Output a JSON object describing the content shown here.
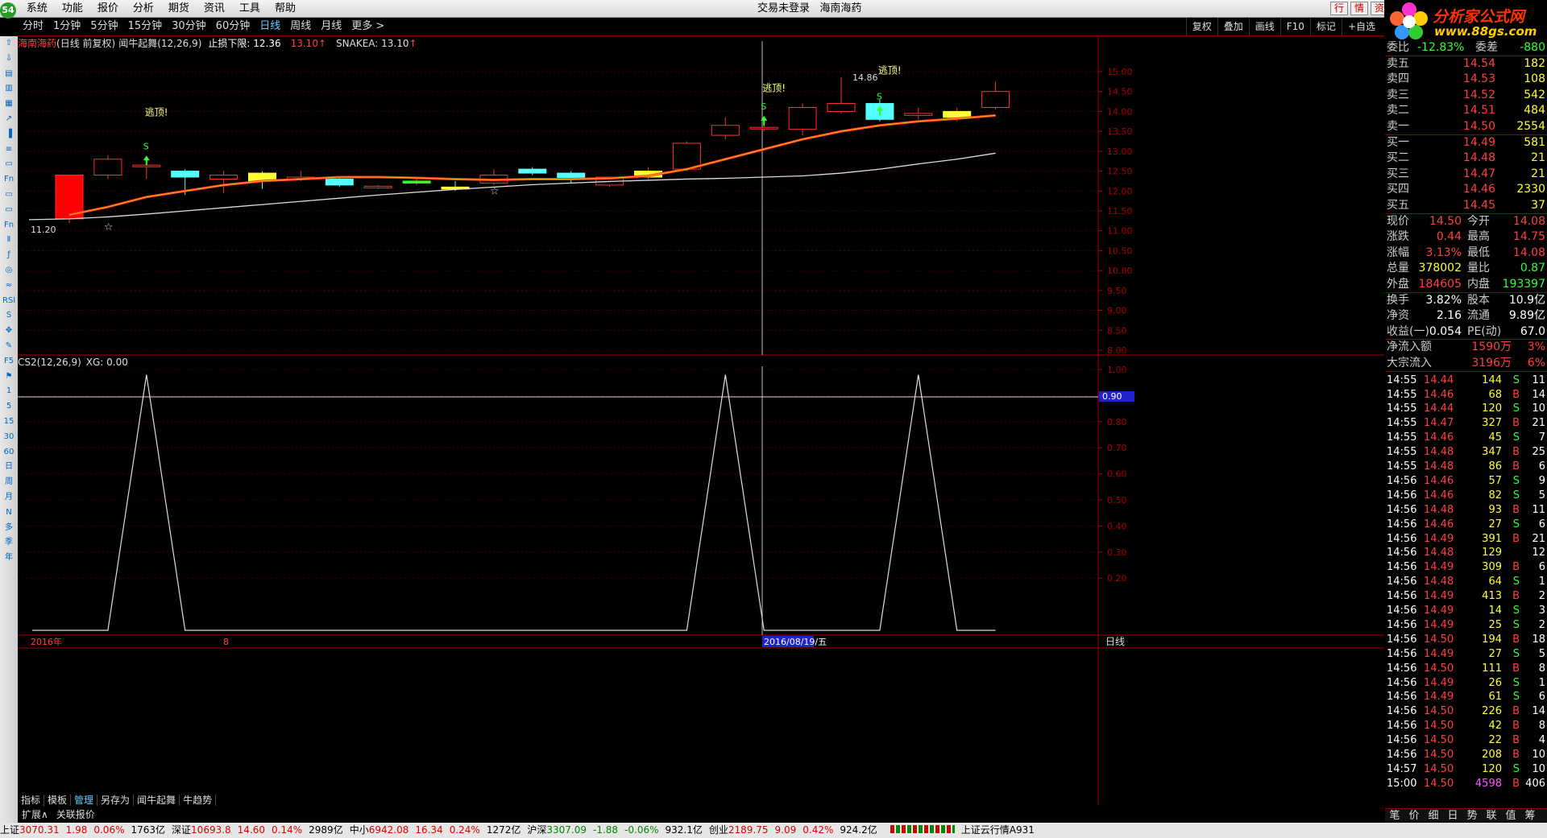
{
  "menu": [
    "系统",
    "功能",
    "报价",
    "分析",
    "期货",
    "资讯",
    "工具",
    "帮助"
  ],
  "app_badge": "54",
  "window_title": {
    "login": "交易未登录",
    "stock": "海南海药"
  },
  "top_right_buttons": [
    "行",
    "情",
    "资"
  ],
  "brand": {
    "name": "分析家公式网",
    "url": "www.88gs.com"
  },
  "periods": [
    "分时",
    "1分钟",
    "5分钟",
    "15分钟",
    "30分钟",
    "60分钟",
    "日线",
    "周线",
    "月线",
    "更多 >"
  ],
  "active_period": "日线",
  "chart_tools": [
    "复权",
    "叠加",
    "画线",
    "F10",
    "标记",
    "+自选"
  ],
  "left_toolbar": [
    "⇧",
    "⇩",
    "▤",
    "▥",
    "▦",
    "↗",
    "▐",
    "≡",
    "▭",
    "Fn",
    "▭",
    "▭",
    "Fn",
    "Ⅱ",
    "ƒ",
    "◎",
    "≈",
    "RSI",
    "S",
    "✥",
    "✎",
    "F5",
    "⚑",
    "1",
    "5",
    "15",
    "30",
    "60",
    "日",
    "周",
    "月",
    "N",
    "多",
    "季",
    "年"
  ],
  "main_header": {
    "stock": "海南海药",
    "mode": "(日线 前复权)",
    "indicator": "闻牛起舞(12,26,9)",
    "stop_label": "止损下限: 12.36",
    "stop_value": "13.10",
    "snake": "SNAKEA: 13.10"
  },
  "price_axis": [
    "15.00",
    "14.50",
    "14.00",
    "13.50",
    "13.00",
    "12.50",
    "12.00",
    "11.50",
    "11.00",
    "10.50",
    "10.00",
    "9.50",
    "9.00",
    "8.50",
    "8.00"
  ],
  "annotations": {
    "low_label": "11.20",
    "high_label": "14.86",
    "escape": "逃顶!",
    "s": "S"
  },
  "sub_header": {
    "name": "CS2(12,26,9)",
    "xg": "XG: 0.00"
  },
  "sub_axis": [
    "1.00",
    "0.90",
    "0.80",
    "0.70",
    "0.60",
    "0.50",
    "0.40",
    "0.30",
    "0.20"
  ],
  "sub_marker": "0.90",
  "date_axis": {
    "year": "2016年",
    "month": "8",
    "cursor": "2016/08/19/五",
    "period": "日线"
  },
  "candles": [
    {
      "o": 11.3,
      "c": 12.4,
      "h": 12.4,
      "l": 11.2,
      "hl": "yel"
    },
    {
      "o": 12.4,
      "c": 12.8,
      "h": 12.9,
      "l": 12.3
    },
    {
      "o": 12.65,
      "c": 12.65,
      "h": 12.75,
      "l": 12.3,
      "cross": true
    },
    {
      "o": 12.5,
      "c": 12.35,
      "h": 12.55,
      "l": 11.9,
      "fill": "#5ff"
    },
    {
      "o": 12.3,
      "c": 12.4,
      "h": 12.5,
      "l": 11.95
    },
    {
      "o": 12.45,
      "c": 12.25,
      "h": 12.5,
      "l": 12.05,
      "fill": "#ff3"
    },
    {
      "o": 12.3,
      "c": 12.35,
      "h": 12.5,
      "l": 12.25,
      "cross": true
    },
    {
      "o": 12.3,
      "c": 12.15,
      "h": 12.35,
      "l": 12.1,
      "fill": "#5ff"
    },
    {
      "o": 12.1,
      "c": 12.12,
      "h": 12.15,
      "l": 12.05,
      "cross": true
    },
    {
      "o": 12.2,
      "c": 12.25,
      "h": 12.3,
      "l": 12.15,
      "cross": true,
      "fill": "#3f3"
    },
    {
      "o": 12.1,
      "c": 12.05,
      "h": 12.25,
      "l": 12.0,
      "fill": "#ff3"
    },
    {
      "o": 12.2,
      "c": 12.4,
      "h": 12.55,
      "l": 12.15
    },
    {
      "o": 12.55,
      "c": 12.45,
      "h": 12.6,
      "l": 12.4,
      "fill": "#5ff"
    },
    {
      "o": 12.45,
      "c": 12.3,
      "h": 12.5,
      "l": 12.2,
      "fill": "#5ff"
    },
    {
      "o": 12.15,
      "c": 12.35,
      "h": 12.35,
      "l": 12.1
    },
    {
      "o": 12.35,
      "c": 12.5,
      "h": 12.6,
      "l": 12.3,
      "fill": "#ff3"
    },
    {
      "o": 12.55,
      "c": 13.2,
      "h": 13.25,
      "l": 12.5
    },
    {
      "o": 13.4,
      "c": 13.65,
      "h": 13.85,
      "l": 13.3
    },
    {
      "o": 13.6,
      "c": 13.6,
      "h": 13.8,
      "l": 13.5,
      "cross": true
    },
    {
      "o": 13.55,
      "c": 14.1,
      "h": 14.2,
      "l": 13.4
    },
    {
      "o": 14.0,
      "c": 14.2,
      "h": 14.86,
      "l": 13.95
    },
    {
      "o": 14.2,
      "c": 13.8,
      "h": 14.3,
      "l": 13.75,
      "fill": "#5ff"
    },
    {
      "o": 13.9,
      "c": 13.95,
      "h": 14.1,
      "l": 13.8,
      "cross": true
    },
    {
      "o": 13.85,
      "c": 14.0,
      "h": 14.1,
      "l": 13.75,
      "fill": "#ff3"
    },
    {
      "o": 14.1,
      "c": 14.5,
      "h": 14.75,
      "l": 14.05
    }
  ],
  "ma_red": [
    11.4,
    11.6,
    11.85,
    12.0,
    12.15,
    12.25,
    12.3,
    12.35,
    12.35,
    12.33,
    12.3,
    12.28,
    12.3,
    12.3,
    12.32,
    12.38,
    12.55,
    12.8,
    13.05,
    13.3,
    13.5,
    13.65,
    13.75,
    13.82,
    13.9
  ],
  "ma_white": [
    11.3,
    11.35,
    11.42,
    11.5,
    11.58,
    11.66,
    11.74,
    11.82,
    11.9,
    11.97,
    12.04,
    12.1,
    12.16,
    12.2,
    12.24,
    12.27,
    12.3,
    12.32,
    12.35,
    12.38,
    12.45,
    12.55,
    12.68,
    12.8,
    12.95
  ],
  "sub_series": [
    0,
    0,
    0.98,
    0,
    0,
    0,
    0,
    0,
    0,
    0,
    0,
    0,
    0,
    0,
    0,
    0,
    0,
    0.98,
    0,
    0,
    0,
    0,
    0.98,
    0,
    0
  ],
  "quote": {
    "weibi": {
      "label": "委比",
      "value": "-12.83%",
      "label2": "委差",
      "value2": "-880"
    },
    "sell": [
      {
        "l": "卖五",
        "p": "14.54",
        "v": "182"
      },
      {
        "l": "卖四",
        "p": "14.53",
        "v": "108"
      },
      {
        "l": "卖三",
        "p": "14.52",
        "v": "542"
      },
      {
        "l": "卖二",
        "p": "14.51",
        "v": "484"
      },
      {
        "l": "卖一",
        "p": "14.50",
        "v": "2554"
      }
    ],
    "buy": [
      {
        "l": "买一",
        "p": "14.49",
        "v": "581"
      },
      {
        "l": "买二",
        "p": "14.48",
        "v": "21"
      },
      {
        "l": "买三",
        "p": "14.47",
        "v": "21"
      },
      {
        "l": "买四",
        "p": "14.46",
        "v": "2330"
      },
      {
        "l": "买五",
        "p": "14.45",
        "v": "37"
      }
    ],
    "stats": [
      {
        "l": "现价",
        "v": "14.50",
        "l2": "今开",
        "v2": "14.08"
      },
      {
        "l": "涨跌",
        "v": "0.44",
        "l2": "最高",
        "v2": "14.75"
      },
      {
        "l": "涨幅",
        "v": "3.13%",
        "l2": "最低",
        "v2": "14.08"
      },
      {
        "l": "总量",
        "v": "378002",
        "l2": "量比",
        "v2": "0.87"
      },
      {
        "l": "外盘",
        "v": "184605",
        "l2": "内盘",
        "v2": "193397"
      }
    ],
    "stats2": [
      {
        "l": "换手",
        "v": "3.82%",
        "l2": "股本",
        "v2": "10.9亿"
      },
      {
        "l": "净资",
        "v": "2.16",
        "l2": "流通",
        "v2": "9.89亿"
      },
      {
        "l": "收益(一)",
        "v": "0.054",
        "l2": "PE(动)",
        "v2": "67.0"
      }
    ],
    "flow": [
      {
        "l": "净流入额",
        "v": "1590万",
        "p": "3%"
      },
      {
        "l": "大宗流入",
        "v": "3196万",
        "p": "6%"
      }
    ]
  },
  "ticks": [
    [
      "14:55",
      "14.44",
      "144",
      "S",
      "11"
    ],
    [
      "14:55",
      "14.46",
      "68",
      "B",
      "14"
    ],
    [
      "14:55",
      "14.44",
      "120",
      "S",
      "10"
    ],
    [
      "14:55",
      "14.47",
      "327",
      "B",
      "21"
    ],
    [
      "14:55",
      "14.46",
      "45",
      "S",
      "7"
    ],
    [
      "14:55",
      "14.48",
      "347",
      "B",
      "25"
    ],
    [
      "14:55",
      "14.48",
      "86",
      "B",
      "6"
    ],
    [
      "14:56",
      "14.46",
      "57",
      "S",
      "9"
    ],
    [
      "14:56",
      "14.46",
      "82",
      "S",
      "5"
    ],
    [
      "14:56",
      "14.48",
      "93",
      "B",
      "11"
    ],
    [
      "14:56",
      "14.46",
      "27",
      "S",
      "6"
    ],
    [
      "14:56",
      "14.49",
      "391",
      "B",
      "21"
    ],
    [
      "14:56",
      "14.48",
      "129",
      "",
      "12"
    ],
    [
      "14:56",
      "14.49",
      "309",
      "B",
      "6"
    ],
    [
      "14:56",
      "14.48",
      "64",
      "S",
      "1"
    ],
    [
      "14:56",
      "14.49",
      "413",
      "B",
      "2"
    ],
    [
      "14:56",
      "14.49",
      "14",
      "S",
      "3"
    ],
    [
      "14:56",
      "14.49",
      "25",
      "S",
      "2"
    ],
    [
      "14:56",
      "14.50",
      "194",
      "B",
      "18"
    ],
    [
      "14:56",
      "14.49",
      "27",
      "S",
      "5"
    ],
    [
      "14:56",
      "14.50",
      "111",
      "B",
      "8"
    ],
    [
      "14:56",
      "14.49",
      "26",
      "S",
      "1"
    ],
    [
      "14:56",
      "14.49",
      "61",
      "S",
      "6"
    ],
    [
      "14:56",
      "14.50",
      "226",
      "B",
      "14"
    ],
    [
      "14:56",
      "14.50",
      "42",
      "B",
      "8"
    ],
    [
      "14:56",
      "14.50",
      "22",
      "B",
      "4"
    ],
    [
      "14:56",
      "14.50",
      "208",
      "B",
      "10"
    ],
    [
      "14:57",
      "14.50",
      "120",
      "S",
      "10"
    ],
    [
      "15:00",
      "14.50",
      "4598",
      "B",
      "406"
    ]
  ],
  "right_tabs": [
    "笔",
    "价",
    "细",
    "日",
    "势",
    "联",
    "值",
    "筹"
  ],
  "bottom_tabs": [
    "指标",
    "模板",
    "管理",
    "另存为",
    "闻牛起舞",
    "牛趋势"
  ],
  "active_bottom_tab": "管理",
  "ext_tabs": [
    "扩展∧",
    "关联报价"
  ],
  "status": [
    {
      "name": "上证",
      "idx": "3070.31",
      "chg": "1.98",
      "pct": "0.06%",
      "amt": "1763亿"
    },
    {
      "name": "深证",
      "idx": "10693.8",
      "chg": "14.60",
      "pct": "0.14%",
      "amt": "2989亿"
    },
    {
      "name": "中小",
      "idx": "6942.08",
      "chg": "16.34",
      "pct": "0.24%",
      "amt": "1272亿"
    },
    {
      "name": "沪深",
      "idx": "3307.09",
      "chg": "-1.88",
      "pct": "-0.06%",
      "amt": "932.1亿"
    },
    {
      "name": "创业",
      "idx": "2189.75",
      "chg": "9.09",
      "pct": "0.42%",
      "amt": "924.2亿"
    }
  ],
  "status_right": "上证云行情A931"
}
